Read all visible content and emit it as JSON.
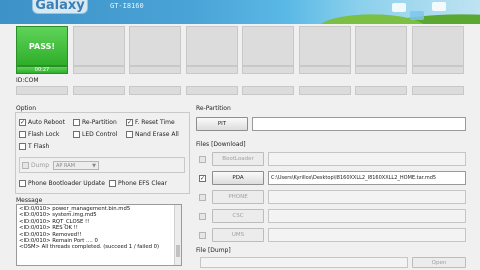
{
  "banner": {
    "logo": "Galaxy",
    "model": "GT-I8160"
  },
  "ports": [
    {
      "label": "PASS!",
      "time": "00:27",
      "active": true
    },
    {
      "label": "",
      "time": "",
      "active": false
    },
    {
      "label": "",
      "time": "",
      "active": false
    },
    {
      "label": "",
      "time": "",
      "active": false
    },
    {
      "label": "",
      "time": "",
      "active": false
    },
    {
      "label": "",
      "time": "",
      "active": false
    },
    {
      "label": "",
      "time": "",
      "active": false
    },
    {
      "label": "",
      "time": "",
      "active": false
    }
  ],
  "idcom_label": "ID:COM",
  "option": {
    "title": "Option",
    "auto_reboot": "Auto Reboot",
    "re_partition": "Re-Partition",
    "f_reset_time": "F. Reset Time",
    "flash_lock": "Flash Lock",
    "led_control": "LED Control",
    "nand_erase_all": "Nand Erase All",
    "t_flash": "T Flash",
    "dump": "Dump",
    "dump_select": "AP RAM",
    "phone_bootloader_update": "Phone Bootloader Update",
    "phone_efs_clear": "Phone EFS Clear",
    "check": "✓"
  },
  "message": {
    "title": "Message",
    "lines": [
      "<ID:0/010> power_management.bin.md5",
      "<ID:0/010> system.img.md5",
      "<ID:0/010> RQT_CLOSE !!",
      "<ID:0/010> RES OK !!",
      "<ID:0/010> Removed!!",
      "<ID:0/010> Remain Port .... 0",
      "<OSM> All threads completed. (succeed 1 / failed 0)"
    ]
  },
  "repartition": {
    "title": "Re-Partition",
    "pit": "PIT"
  },
  "files": {
    "title": "Files [Download]",
    "bootloader": "BootLoader",
    "pda": "PDA",
    "pda_path": "C:\\Users\\Kyrillos\\Desktop\\I8160XXLL2_I8160XXLL2_HOME.tar.md5",
    "phone": "PHONE",
    "csc": "CSC",
    "ums": "UMS"
  },
  "dump_files": {
    "title": "File [Dump]",
    "open": "Open"
  }
}
